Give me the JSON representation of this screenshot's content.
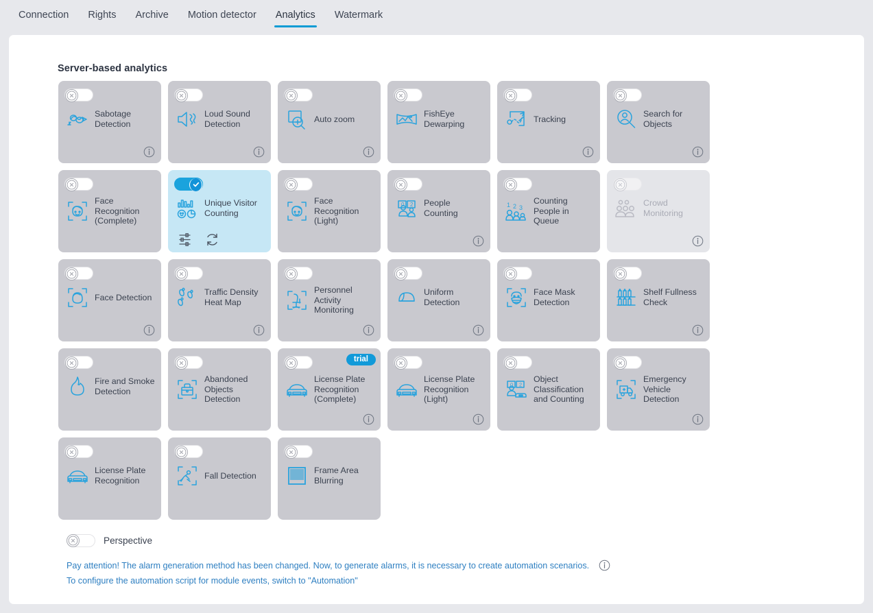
{
  "tabs": [
    {
      "label": "Connection",
      "active": false
    },
    {
      "label": "Rights",
      "active": false
    },
    {
      "label": "Archive",
      "active": false
    },
    {
      "label": "Motion detector",
      "active": false
    },
    {
      "label": "Analytics",
      "active": true
    },
    {
      "label": "Watermark",
      "active": false
    }
  ],
  "section": {
    "title": "Server-based analytics"
  },
  "colors": {
    "accent": "#0a9bd4",
    "icon_blue": "#29a3dd",
    "card_bg": "#c9c9cf",
    "card_active_bg": "#c6e7f5",
    "card_disabled_bg": "#e4e5e9",
    "page_bg": "#e7e8ec",
    "link_blue": "#2e7fc1",
    "trial_badge": "#129ad9"
  },
  "cards": [
    {
      "label": "Sabotage Detection",
      "icon": "sabotage-icon",
      "enabled": false,
      "state": "normal",
      "info": true,
      "trial": false
    },
    {
      "label": "Loud Sound Detection",
      "icon": "speaker-icon",
      "enabled": false,
      "state": "normal",
      "info": true,
      "trial": false
    },
    {
      "label": "Auto zoom",
      "icon": "zoom-in-icon",
      "enabled": false,
      "state": "normal",
      "info": true,
      "trial": false
    },
    {
      "label": "FishEye Dewarping",
      "icon": "fisheye-icon",
      "enabled": false,
      "state": "normal",
      "info": false,
      "trial": false
    },
    {
      "label": "Tracking",
      "icon": "tracking-icon",
      "enabled": false,
      "state": "normal",
      "info": true,
      "trial": false
    },
    {
      "label": "Search for Objects",
      "icon": "search-person-icon",
      "enabled": false,
      "state": "normal",
      "info": true,
      "trial": false
    },
    {
      "label": "Face Recognition (Complete)",
      "icon": "face-frame-icon",
      "enabled": false,
      "state": "normal",
      "info": false,
      "trial": false
    },
    {
      "label": "Unique Visitor Counting",
      "icon": "chart-visitor-icon",
      "enabled": true,
      "state": "active",
      "info": false,
      "trial": false,
      "actions": [
        "settings-sliders-icon",
        "refresh-icon"
      ]
    },
    {
      "label": "Face Recognition (Light)",
      "icon": "face-frame-icon",
      "enabled": false,
      "state": "normal",
      "info": false,
      "trial": false
    },
    {
      "label": "People Counting",
      "icon": "people-counting-icon",
      "enabled": false,
      "state": "normal",
      "info": true,
      "trial": false
    },
    {
      "label": "Counting People in Queue",
      "icon": "queue-counting-icon",
      "enabled": false,
      "state": "normal",
      "info": false,
      "trial": false
    },
    {
      "label": "Crowd Monitoring",
      "icon": "crowd-icon",
      "enabled": false,
      "state": "disabled",
      "info": true,
      "trial": false
    },
    {
      "label": "Face Detection",
      "icon": "face-detect-icon",
      "enabled": false,
      "state": "normal",
      "info": true,
      "trial": false
    },
    {
      "label": "Traffic Density Heat Map",
      "icon": "footprints-icon",
      "enabled": false,
      "state": "normal",
      "info": true,
      "trial": false
    },
    {
      "label": "Personnel Activity Monitoring",
      "icon": "chair-frame-icon",
      "enabled": false,
      "state": "normal",
      "info": true,
      "trial": false
    },
    {
      "label": "Uniform Detection",
      "icon": "helmet-icon",
      "enabled": false,
      "state": "normal",
      "info": true,
      "trial": false
    },
    {
      "label": "Face Mask Detection",
      "icon": "mask-face-icon",
      "enabled": false,
      "state": "normal",
      "info": false,
      "trial": false
    },
    {
      "label": "Shelf Fullness Check",
      "icon": "shelf-icon",
      "enabled": false,
      "state": "normal",
      "info": true,
      "trial": false
    },
    {
      "label": "Fire and Smoke Detection",
      "icon": "flame-icon",
      "enabled": false,
      "state": "normal",
      "info": false,
      "trial": false
    },
    {
      "label": "Abandoned Objects Detection",
      "icon": "bag-frame-icon",
      "enabled": false,
      "state": "normal",
      "info": false,
      "trial": false
    },
    {
      "label": "License Plate Recognition (Complete)",
      "icon": "car-plate-icon",
      "enabled": false,
      "state": "normal",
      "info": true,
      "trial": true,
      "trial_label": "trial"
    },
    {
      "label": "License Plate Recognition (Light)",
      "icon": "car-plate-icon",
      "enabled": false,
      "state": "normal",
      "info": true,
      "trial": false
    },
    {
      "label": "Object Classification and Counting",
      "icon": "object-classify-icon",
      "enabled": false,
      "state": "normal",
      "info": false,
      "trial": false
    },
    {
      "label": "Emergency Vehicle Detection",
      "icon": "ambulance-frame-icon",
      "enabled": false,
      "state": "normal",
      "info": true,
      "trial": false
    },
    {
      "label": "License Plate Recognition",
      "icon": "car-plate-icon",
      "enabled": false,
      "state": "normal",
      "info": false,
      "trial": false
    },
    {
      "label": "Fall Detection",
      "icon": "fall-frame-icon",
      "enabled": false,
      "state": "normal",
      "info": false,
      "trial": false
    },
    {
      "label": "Frame Area Blurring",
      "icon": "blur-area-icon",
      "enabled": false,
      "state": "normal",
      "info": false,
      "trial": false
    }
  ],
  "perspective": {
    "label": "Perspective",
    "enabled": false
  },
  "notices": {
    "line1": "Pay attention! The alarm generation method has been changed. Now, to generate alarms, it is necessary to create automation scenarios.",
    "line2": "To configure the automation script for module events, switch to \"Automation\""
  }
}
